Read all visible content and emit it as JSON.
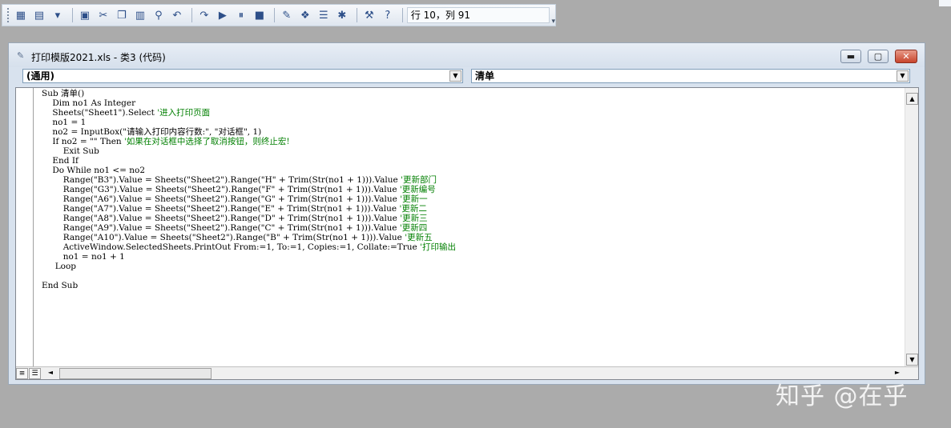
{
  "toolbar": {
    "buttons": [
      {
        "name": "excel-icon",
        "glyph": "▦"
      },
      {
        "name": "insert-userform-icon",
        "glyph": "▤"
      },
      {
        "name": "dropdown-arrow-icon",
        "glyph": "▾"
      },
      {
        "name": "save-icon",
        "glyph": "▣"
      },
      {
        "name": "cut-icon",
        "glyph": "✂"
      },
      {
        "name": "copy-icon",
        "glyph": "❐"
      },
      {
        "name": "paste-icon",
        "glyph": "▥"
      },
      {
        "name": "find-icon",
        "glyph": "⚲"
      },
      {
        "name": "undo-icon",
        "glyph": "↶"
      },
      {
        "name": "redo-icon",
        "glyph": "↷"
      },
      {
        "name": "run-icon",
        "glyph": "▶"
      },
      {
        "name": "break-icon",
        "glyph": "⏸"
      },
      {
        "name": "reset-icon",
        "glyph": "■"
      },
      {
        "name": "design-mode-icon",
        "glyph": "✎"
      },
      {
        "name": "project-explorer-icon",
        "glyph": "❖"
      },
      {
        "name": "properties-icon",
        "glyph": "☰"
      },
      {
        "name": "object-browser-icon",
        "glyph": "✱"
      },
      {
        "name": "toolbox-icon",
        "glyph": "⚒"
      },
      {
        "name": "help-icon",
        "glyph": "?"
      }
    ],
    "position_text": "行 10，列 91"
  },
  "window": {
    "title": "打印模版2021.xls - 类3 (代码)",
    "min_glyph": "▬",
    "max_glyph": "▢",
    "close_glyph": "✕"
  },
  "object_combo": {
    "value": "(通用)"
  },
  "proc_combo": {
    "value": "清单"
  },
  "code_lines": [
    {
      "c": "Sub 清单()",
      "m": ""
    },
    {
      "c": "    Dim no1 As Integer",
      "m": ""
    },
    {
      "c": "    Sheets(\"Sheet1\").Select ",
      "m": "'进入打印页面"
    },
    {
      "c": "    no1 = 1",
      "m": ""
    },
    {
      "c": "    no2 = InputBox(\"请输入打印内容行数:\", \"对话框\", 1)",
      "m": ""
    },
    {
      "c": "    If no2 = \"\" Then ",
      "m": "'如果在对话框中选择了取消按钮，则终止宏!"
    },
    {
      "c": "        Exit Sub",
      "m": ""
    },
    {
      "c": "    End If",
      "m": ""
    },
    {
      "c": "    Do While no1 <= no2",
      "m": ""
    },
    {
      "c": "        Range(\"B3\").Value = Sheets(\"Sheet2\").Range(\"H\" + Trim(Str(no1 + 1))).Value ",
      "m": "'更新部门"
    },
    {
      "c": "        Range(\"G3\").Value = Sheets(\"Sheet2\").Range(\"F\" + Trim(Str(no1 + 1))).Value ",
      "m": "'更新编号"
    },
    {
      "c": "        Range(\"A6\").Value = Sheets(\"Sheet2\").Range(\"G\" + Trim(Str(no1 + 1))).Value ",
      "m": "'更新一"
    },
    {
      "c": "        Range(\"A7\").Value = Sheets(\"Sheet2\").Range(\"E\" + Trim(Str(no1 + 1))).Value ",
      "m": "'更新二"
    },
    {
      "c": "        Range(\"A8\").Value = Sheets(\"Sheet2\").Range(\"D\" + Trim(Str(no1 + 1))).Value ",
      "m": "'更新三"
    },
    {
      "c": "        Range(\"A9\").Value = Sheets(\"Sheet2\").Range(\"C\" + Trim(Str(no1 + 1))).Value ",
      "m": "'更新四"
    },
    {
      "c": "        Range(\"A10\").Value = Sheets(\"Sheet2\").Range(\"B\" + Trim(Str(no1 + 1))).Value ",
      "m": "'更新五"
    },
    {
      "c": "        ActiveWindow.SelectedSheets.PrintOut From:=1, To:=1, Copies:=1, Collate:=True ",
      "m": "'打印输出"
    },
    {
      "c": "        no1 = no1 + 1",
      "m": ""
    },
    {
      "c": "     Loop",
      "m": ""
    },
    {
      "c": "",
      "m": ""
    },
    {
      "c": "End Sub",
      "m": ""
    }
  ],
  "scroll": {
    "up": "▲",
    "down": "▼",
    "left": "◄",
    "right": "►"
  },
  "view_buttons": {
    "procedure": "≡",
    "full_module": "☰"
  },
  "watermark": "知乎 @在乎"
}
